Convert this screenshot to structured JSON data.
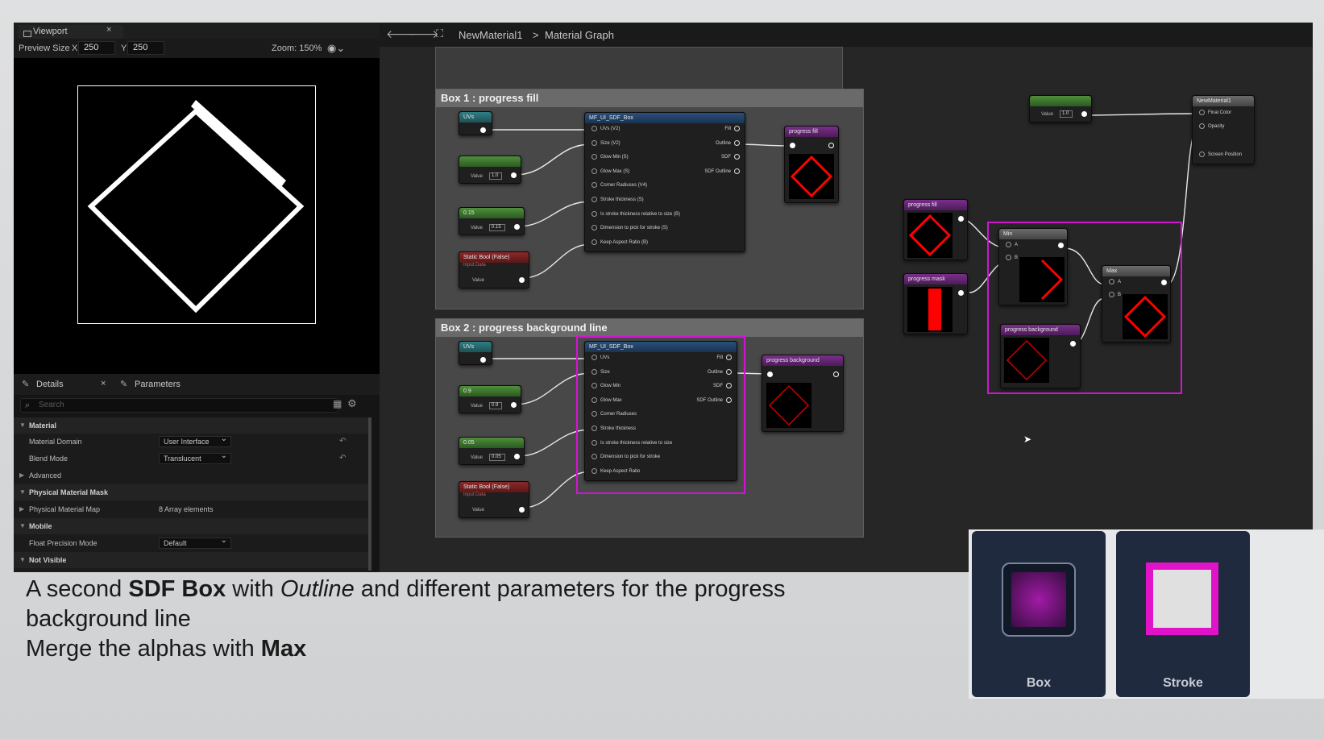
{
  "viewport": {
    "tab_title": "Viewport",
    "preview_size_label": "Preview Size",
    "x_label": "X",
    "x_value": "250",
    "y_label": "Y",
    "y_value": "250",
    "zoom": "Zoom: 150%"
  },
  "details": {
    "tab_details": "Details",
    "tab_parameters": "Parameters",
    "search_placeholder": "Search",
    "sections": {
      "material": "Material",
      "material_domain_label": "Material Domain",
      "material_domain_value": "User Interface",
      "blend_mode_label": "Blend Mode",
      "blend_mode_value": "Translucent",
      "advanced": "Advanced",
      "physical_material_mask": "Physical Material Mask",
      "physical_material_map_label": "Physical Material Map",
      "physical_material_map_value": "8 Array elements",
      "mobile": "Mobile",
      "float_precision_label": "Float Precision Mode",
      "float_precision_value": "Default",
      "not_visible": "Not Visible"
    }
  },
  "graph": {
    "breadcrumb_root": "NewMaterial1",
    "breadcrumb_sep": ">",
    "breadcrumb_current": "Material Graph",
    "box1_title": "Box 1 : progress fill",
    "box2_title": "Box 2 : progress background line",
    "uvs": "UVs",
    "value_label": "Value",
    "v1": "1.0",
    "v015": "0.15",
    "v09": "0.9",
    "v005": "0.05",
    "static_bool": "Static Bool (False)",
    "input_data": "Input Data",
    "sdf_func": "MF_UI_SDF_Box",
    "sdf_inputs_1": [
      "UVs (V2)",
      "Size (V2)",
      "Glow Min (S)",
      "Glow Max (S)",
      "Corner Radiuses (V4)",
      "Stroke thickness (S)",
      "Is stroke thickness relative to size (B)",
      "Dimension to pick for stroke (S)",
      "Keep Aspect Ratio (B)"
    ],
    "sdf_inputs_2": [
      "UVs",
      "Size",
      "Glow Min",
      "Glow Max",
      "Corner Radiuses",
      "Stroke thickness",
      "Is stroke thickness relative to size",
      "Dimension to pick for stroke",
      "Keep Aspect Ratio"
    ],
    "sdf_outputs": [
      "Fill",
      "Outline",
      "SDF",
      "SDF Outline"
    ],
    "progress_fill": "progress fill",
    "progress_background": "progress background",
    "progress_mask": "progress mask",
    "min": "Min",
    "max": "Max",
    "a": "A",
    "b": "B",
    "material_node": "NewMaterial1",
    "material_pins": [
      "Final Color",
      "Opacity",
      "Screen Position"
    ],
    "value_1_0": "1.0"
  },
  "caption": {
    "line1_pre": "A second ",
    "line1_bold": "SDF Box",
    "line1_mid": " with ",
    "line1_italic": "Outline",
    "line1_post": " and different parameters for the progress",
    "line2": "background line",
    "line3_pre": "Merge the alphas with ",
    "line3_bold": "Max"
  },
  "cards": {
    "box_label": "Box",
    "stroke_label": "Stroke"
  }
}
